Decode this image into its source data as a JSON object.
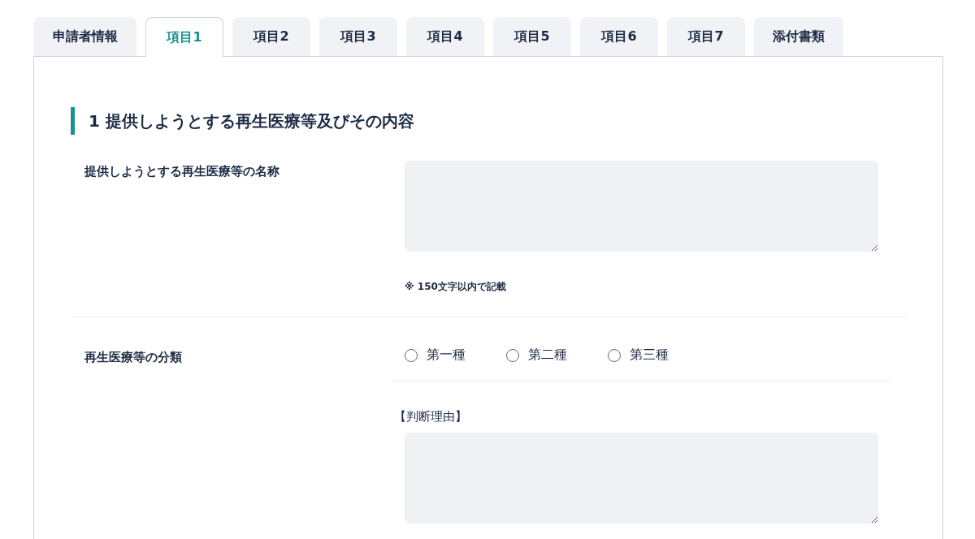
{
  "tabs": [
    {
      "label": "申請者情報",
      "selected": false
    },
    {
      "label": "項目1",
      "selected": true
    },
    {
      "label": "項目2",
      "selected": false
    },
    {
      "label": "項目3",
      "selected": false
    },
    {
      "label": "項目4",
      "selected": false
    },
    {
      "label": "項目5",
      "selected": false
    },
    {
      "label": "項目6",
      "selected": false
    },
    {
      "label": "項目7",
      "selected": false
    },
    {
      "label": "添付書類",
      "selected": false
    }
  ],
  "section": {
    "heading": "1 提供しようとする再生医療等及びその内容",
    "name_field": {
      "label": "提供しようとする再生医療等の名称",
      "note": "※ 150文字以内で記載"
    },
    "classification": {
      "label": "再生医療等の分類",
      "options": [
        {
          "label": "第一種",
          "selected": false
        },
        {
          "label": "第二種",
          "selected": false
        },
        {
          "label": "第三種",
          "selected": false
        }
      ],
      "reason_label": "【判断理由】"
    }
  }
}
